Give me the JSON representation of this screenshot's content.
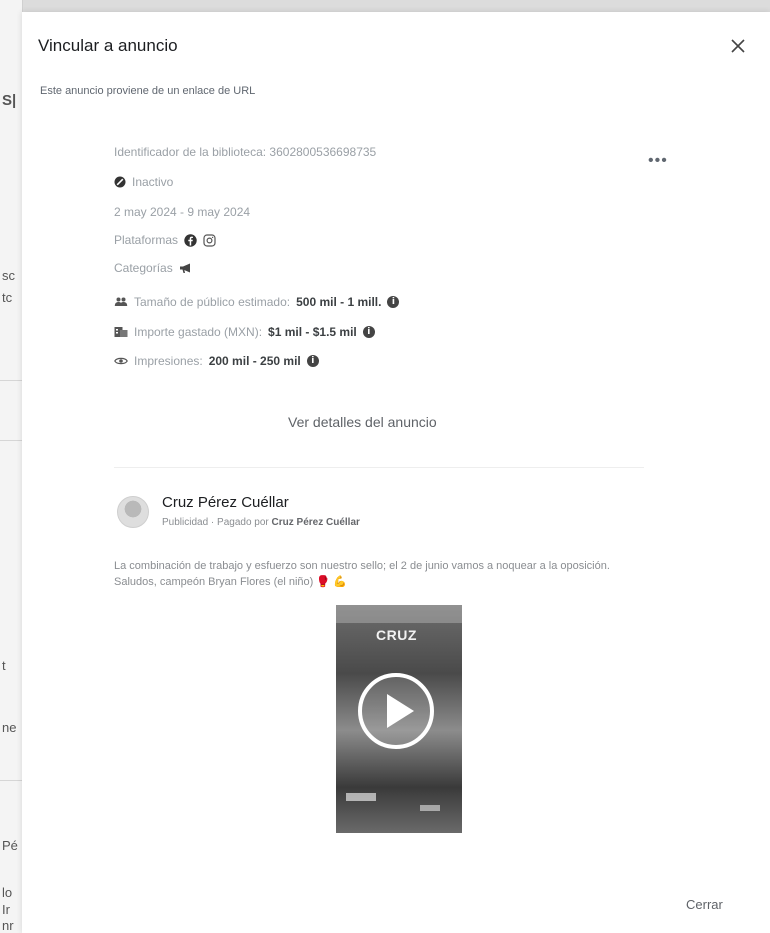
{
  "modal": {
    "title": "Vincular a anuncio",
    "subtitle": "Este anuncio proviene de un enlace de URL",
    "close_footer": "Cerrar"
  },
  "ad": {
    "library_id": "Identificador de la biblioteca: 3602800536698735",
    "status": "Inactivo",
    "date_range": "2 may 2024 - 9 may 2024",
    "platforms_label": "Plataformas",
    "categories_label": "Categorías",
    "audience_label": "Tamaño de público estimado:",
    "audience_value": "500 mil - 1 mill.",
    "spend_label": "Importe gastado (MXN):",
    "spend_value": "$1 mil - $1.5 mil",
    "impressions_label": "Impresiones:",
    "impressions_value": "200 mil - 250 mil",
    "details_link": "Ver detalles del anuncio"
  },
  "post": {
    "advertiser": "Cruz Pérez Cuéllar",
    "sponsor_prefix": "Publicidad · Pagado por",
    "sponsor_name": "Cruz Pérez Cuéllar",
    "text": "La combinación de trabajo y esfuerzo son nuestro sello; el 2 de junio vamos a noquear a la oposición. Saludos, campeón Bryan Flores (el niño) 🥊 💪",
    "video_brand": "CRUZ"
  },
  "background": {
    "fragments": [
      "S|",
      "sc",
      "tc",
      "t",
      "ne",
      "Pé",
      "lo",
      "Ir",
      "nr"
    ]
  },
  "icons": {
    "close": "close-icon",
    "status": "status-inactive-icon",
    "facebook": "facebook-icon",
    "instagram": "instagram-icon",
    "megaphone": "megaphone-icon",
    "audience": "audience-icon",
    "spend": "spend-icon",
    "impressions": "eye-icon",
    "info": "info-icon",
    "play": "play-icon",
    "more": "more-icon"
  }
}
